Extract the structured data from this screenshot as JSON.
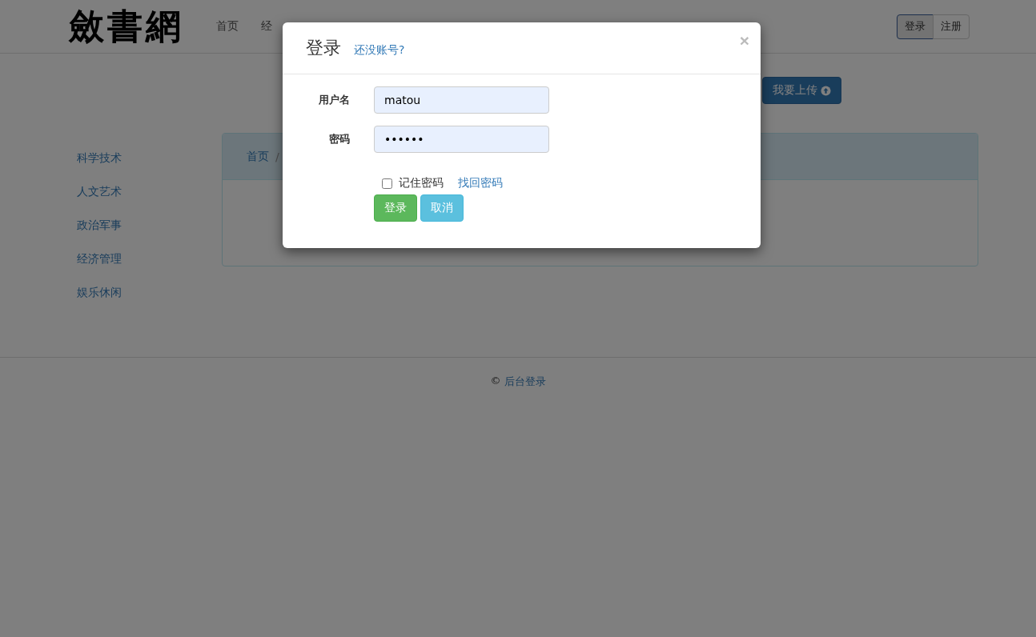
{
  "logo": "斂書網",
  "nav": [
    {
      "label": "首页",
      "selected": false
    },
    {
      "label": "经",
      "selected": false
    }
  ],
  "auth_buttons": [
    {
      "label": "登录",
      "selected": true
    },
    {
      "label": "注册",
      "selected": false
    }
  ],
  "upload_button": "我要上传",
  "sidebar": {
    "items": [
      {
        "label": "科学技术"
      },
      {
        "label": "人文艺术"
      },
      {
        "label": "政治军事"
      },
      {
        "label": "经济管理"
      },
      {
        "label": "娱乐休闲"
      }
    ]
  },
  "breadcrumb": [
    "首页",
    "/"
  ],
  "footer": {
    "copyright": "©",
    "link": "后台登录"
  },
  "modal": {
    "title": "登录",
    "register_link": "还没账号?",
    "close": "×",
    "fields": [
      {
        "label": "用户名",
        "value": "matou"
      },
      {
        "label": "密码",
        "value": "••••••"
      }
    ],
    "remember": {
      "label": "记住密码",
      "checked": false
    },
    "forgot_link": "找回密码",
    "buttons": [
      {
        "label": "登录",
        "kind": "primary"
      },
      {
        "label": "取消",
        "kind": "cancel"
      }
    ]
  }
}
